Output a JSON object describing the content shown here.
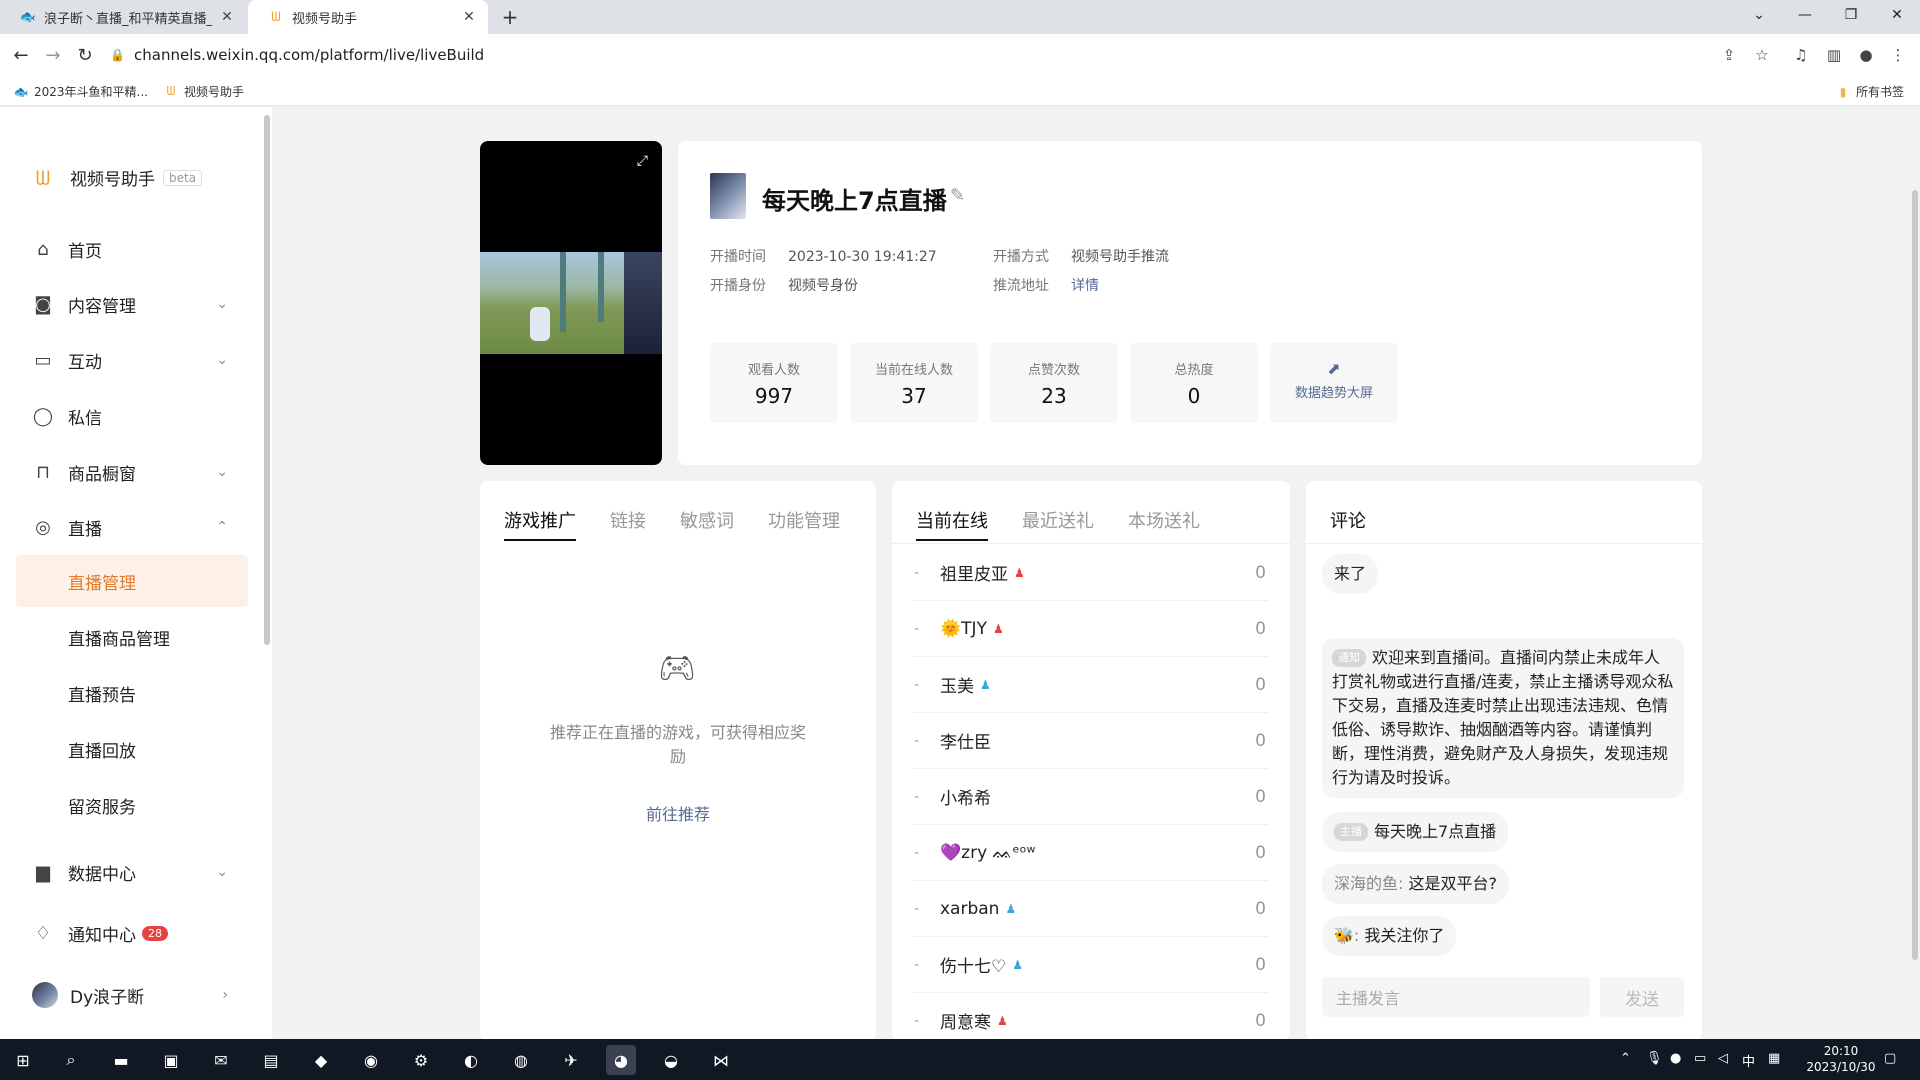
{
  "browser": {
    "tabs": [
      {
        "title": "浪子断丶直播_和平精英直播_斗",
        "favicon": "douyu-icon"
      },
      {
        "title": "视频号助手",
        "favicon": "wechat-channels-icon"
      }
    ],
    "url": "channels.weixin.qq.com/platform/live/liveBuild",
    "bookmarks": [
      {
        "label": "2023年斗鱼和平精..."
      },
      {
        "label": "视频号助手"
      }
    ],
    "all_bookmarks": "所有书签"
  },
  "sidebar": {
    "app_name": "视频号助手",
    "beta": "beta",
    "items": [
      {
        "label": "首页",
        "icon": "home-icon"
      },
      {
        "label": "内容管理",
        "icon": "camera-icon"
      },
      {
        "label": "互动",
        "icon": "chat-square-icon"
      },
      {
        "label": "私信",
        "icon": "chat-bubble-icon"
      },
      {
        "label": "商品橱窗",
        "icon": "bag-icon"
      },
      {
        "label": "直播",
        "icon": "live-icon"
      }
    ],
    "live_sub": [
      {
        "label": "直播管理"
      },
      {
        "label": "直播商品管理"
      },
      {
        "label": "直播预告"
      },
      {
        "label": "直播回放"
      },
      {
        "label": "留资服务"
      }
    ],
    "data_center": "数据中心",
    "notice_center": "通知中心",
    "notice_count": "28",
    "user_name": "Dy浪子断"
  },
  "room": {
    "title": "每天晚上7点直播",
    "start_time_label": "开播时间",
    "start_time": "2023-10-30 19:41:27",
    "identity_label": "开播身份",
    "identity": "视频号身份",
    "mode_label": "开播方式",
    "mode": "视频号助手推流",
    "push_label": "推流地址",
    "push_value": "详情"
  },
  "stats": [
    {
      "label": "观看人数",
      "value": "997"
    },
    {
      "label": "当前在线人数",
      "value": "37"
    },
    {
      "label": "点赞次数",
      "value": "23"
    },
    {
      "label": "总热度",
      "value": "0"
    }
  ],
  "trend_label": "数据趋势大屏",
  "promo": {
    "tabs": [
      "游戏推广",
      "链接",
      "敏感词",
      "功能管理"
    ],
    "desc": "推荐正在直播的游戏，可获得相应奖励",
    "link": "前往推荐"
  },
  "online": {
    "tabs": [
      "当前在线",
      "最近送礼",
      "本场送礼"
    ],
    "users": [
      {
        "name": "祖里皮亚",
        "gender": "female",
        "count": "0"
      },
      {
        "name": "🌞TJY",
        "gender": "female",
        "count": "0"
      },
      {
        "name": "玉美",
        "gender": "male",
        "count": "0"
      },
      {
        "name": "李仕臣",
        "gender": "",
        "count": "0"
      },
      {
        "name": "小希希",
        "gender": "",
        "count": "0"
      },
      {
        "name": "💜zry ᨐᵉᵒʷ",
        "gender": "",
        "count": "0"
      },
      {
        "name": "xarban",
        "gender": "male",
        "count": "0"
      },
      {
        "name": "伤十七♡",
        "gender": "male",
        "count": "0"
      },
      {
        "name": "周意寒",
        "gender": "female",
        "count": "0"
      }
    ]
  },
  "comments": {
    "title": "评论",
    "items": [
      {
        "tag": "",
        "name": "",
        "text": "来了"
      },
      {
        "tag": "通知",
        "name": "",
        "text": "欢迎来到直播间。直播间内禁止未成年人打赏礼物或进行直播/连麦，禁止主播诱导观众私下交易，直播及连麦时禁止出现违法违规、色情低俗、诱导欺诈、抽烟酗酒等内容。请谨慎判断，理性消费，避免财产及人身损失，发现违规行为请及时投诉。"
      },
      {
        "tag": "主播",
        "name": "",
        "text": "每天晚上7点直播"
      },
      {
        "tag": "",
        "name": "深海的鱼: ",
        "text": "这是双平台?"
      },
      {
        "tag": "",
        "name": "🐝: ",
        "text": "我关注你了"
      }
    ],
    "input_placeholder": "主播发言",
    "send": "发送"
  },
  "taskbar": {
    "time": "20:10",
    "date": "2023/10/30",
    "ime": "中"
  }
}
